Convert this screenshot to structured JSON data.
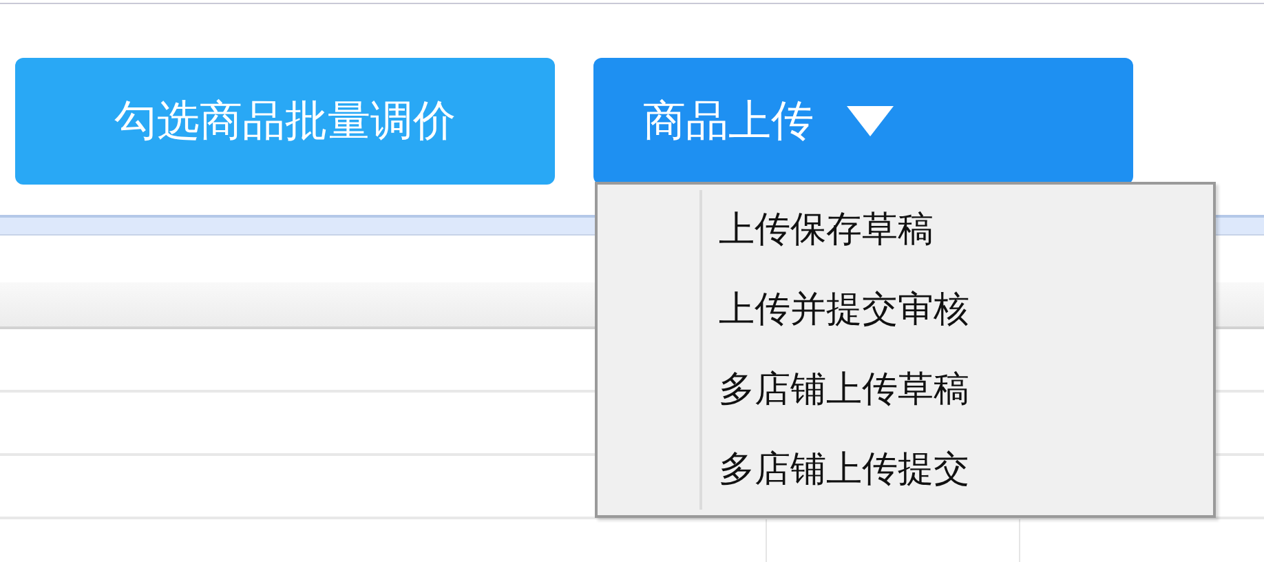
{
  "toolbar": {
    "buttons": [
      {
        "label": "勾选商品批量调价",
        "kind": "plain",
        "color": "#29a8f5"
      },
      {
        "label": "商品上传",
        "kind": "dropdown",
        "color": "#1e90f2",
        "expanded": true
      }
    ]
  },
  "dropdown_menu": {
    "items": [
      {
        "label": "上传保存草稿"
      },
      {
        "label": "上传并提交审核"
      },
      {
        "label": "多店铺上传草稿"
      },
      {
        "label": "多店铺上传提交"
      }
    ]
  }
}
